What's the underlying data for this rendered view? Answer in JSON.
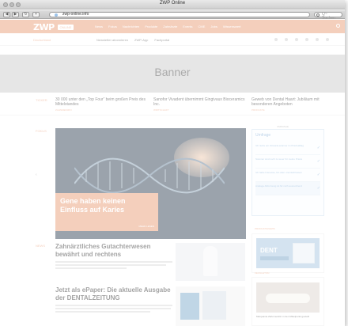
{
  "window": {
    "title": "ZWP Online",
    "url": "zwp-online.info",
    "search_placeholder": "Q~ Suchen"
  },
  "site": {
    "logo": "ZWP",
    "logo_badge": "ONLINE",
    "nav_items": [
      "News",
      "Fokus",
      "Nachrichten",
      "Produkte",
      "Zahnärzte",
      "Events",
      "CME",
      "Jobs",
      "Wissenswert"
    ],
    "region": "Deutschland",
    "subnav_links": [
      "Newsletter abonnieren",
      "ZWP-App",
      "Fachportal"
    ],
    "banner": "Banner"
  },
  "ticker": {
    "label": "TICKER",
    "items": [
      {
        "title": "30 000 unter den „Top Four“ beim großen Preis des Mittelstandes",
        "meta": "ZAHNMEDIZIN"
      },
      {
        "title": "Sanofor Vivadent übernimmt Gingivaux Bioceramics Inc.",
        "meta": "WIRTSCHAFT"
      },
      {
        "title": "Geweb von Dental Haart: Jubiläum mit besonderen Angeboten",
        "meta": "PRODUKTE"
      }
    ]
  },
  "hero": {
    "label": "FOKUS",
    "arrow": "‹",
    "title": "Gene haben keinen Einfluss auf Karies",
    "more": "MEHR LESEN"
  },
  "survey": {
    "header": "UMFRAGE",
    "title": "Umfrage",
    "options": [
      "Ich nutze ein Intraoral-scanner im Praxisalltag",
      "Scanner sind noch zu teuer für meine Praxis",
      "Ich habe Interesse, bin aber unentschlossen",
      "Analoge Abformung ist für mich ausreichend"
    ],
    "active_index": 3
  },
  "ads": {
    "label": "PRODUKTENEWS",
    "ad_title": "DENT",
    "clinic_label": "FEUILLETON",
    "clinic_caption": "Marquante Zahnmedizin in den Mittelpunkt gestellt"
  },
  "articles": [
    {
      "title": "Zahnärztliches Gutachterwesen bewährt und rechtens",
      "lines": 3
    },
    {
      "title": "Jetzt als ePaper: Die aktuelle Ausgabe der DENTALZEITUNG",
      "lines": 3
    }
  ],
  "news_label": "NEWS"
}
